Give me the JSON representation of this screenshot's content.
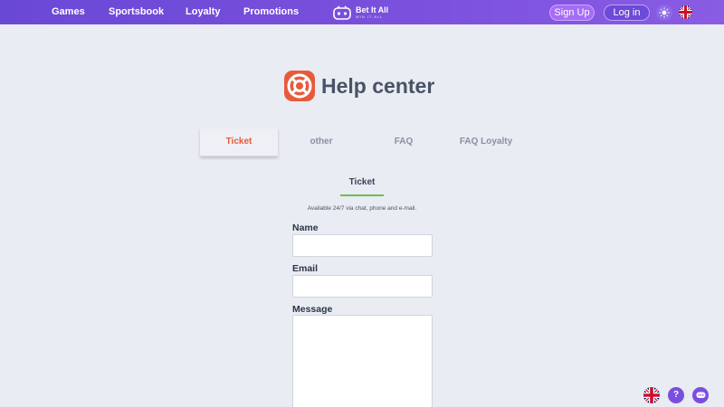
{
  "header": {
    "nav": [
      {
        "label": "Games"
      },
      {
        "label": "Sportsbook"
      },
      {
        "label": "Loyalty"
      },
      {
        "label": "Promotions"
      }
    ],
    "logo": {
      "title": "Bet It All",
      "subtitle": "WIN IT ALL"
    },
    "signup_label": "Sign Up",
    "login_label": "Log in"
  },
  "help": {
    "title": "Help center"
  },
  "tabs": [
    {
      "label": "Ticket",
      "active": true
    },
    {
      "label": "other",
      "active": false
    },
    {
      "label": "FAQ",
      "active": false
    },
    {
      "label": "FAQ Loyalty",
      "active": false
    }
  ],
  "form": {
    "section_title": "Ticket",
    "availability": "Available 24/7 via chat, phone and e-mail.",
    "name_label": "Name",
    "name_value": "",
    "email_label": "Email",
    "email_value": "",
    "message_label": "Message",
    "message_value": ""
  },
  "floating": {
    "help_label": "?"
  },
  "colors": {
    "header_gradient_start": "#6a48d6",
    "header_gradient_end": "#8a5ce4",
    "active_tab": "#e55a3a",
    "underline": "#6bbf4e",
    "background": "#e9ecf3"
  }
}
